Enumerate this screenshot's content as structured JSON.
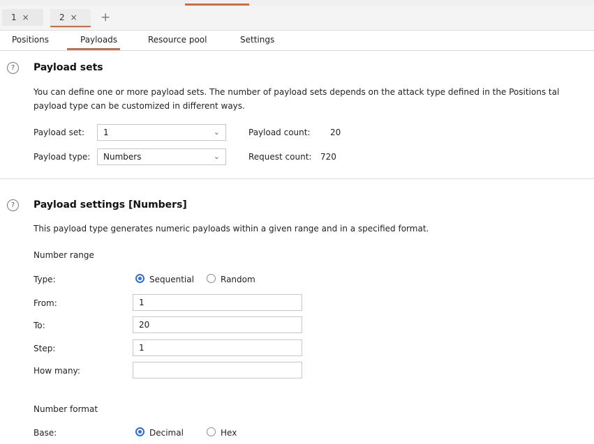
{
  "instance_tabs": [
    {
      "label": "1",
      "close": "×"
    },
    {
      "label": "2",
      "close": "×"
    }
  ],
  "add_tab": "+",
  "sub_tabs": [
    "Positions",
    "Payloads",
    "Resource pool",
    "Settings"
  ],
  "payload_sets": {
    "title": "Payload sets",
    "description_line1": "You can define one or more payload sets. The number of payload sets depends on the attack type defined in the Positions tal",
    "description_line2": "payload type can be customized in different ways.",
    "set_label": "Payload set:",
    "set_value": "1",
    "type_label": "Payload type:",
    "type_value": "Numbers",
    "payload_count_label": "Payload count:",
    "payload_count": "20",
    "request_count_label": "Request count:",
    "request_count": "720"
  },
  "payload_settings": {
    "title": "Payload settings [Numbers]",
    "description": "This payload type generates numeric payloads within a given range and in a specified format.",
    "range_heading": "Number range",
    "type_label": "Type:",
    "type_options": [
      "Sequential",
      "Random"
    ],
    "type_selected": "Sequential",
    "from_label": "From:",
    "from_value": "1",
    "to_label": "To:",
    "to_value": "20",
    "step_label": "Step:",
    "step_value": "1",
    "how_many_label": "How many:",
    "how_many_value": "",
    "format_heading": "Number format",
    "base_label": "Base:",
    "base_options": [
      "Decimal",
      "Hex"
    ],
    "base_selected": "Decimal"
  },
  "colors": {
    "accent": "#e8632c",
    "radio": "#2f6ed3"
  },
  "icons": [
    "close-icon",
    "plus-icon",
    "help-icon",
    "chevron-down-icon"
  ]
}
